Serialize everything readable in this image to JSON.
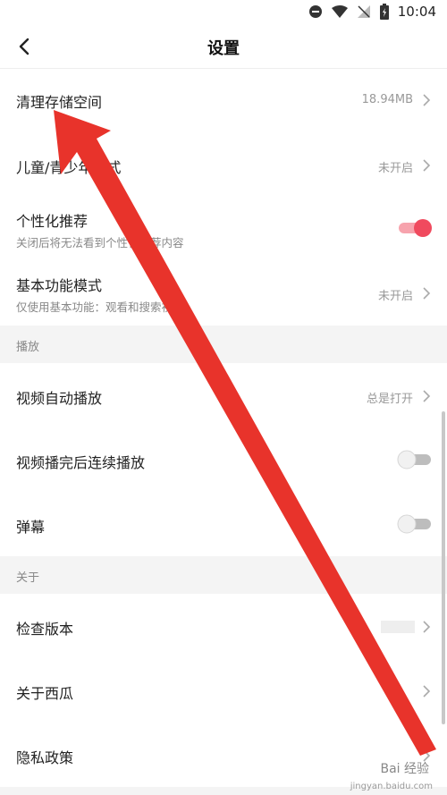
{
  "status": {
    "time": "10:04"
  },
  "header": {
    "title": "设置"
  },
  "rows": [
    {
      "label": "清理存储空间",
      "value": "18.94MB"
    },
    {
      "label": "儿童/青少年模式",
      "value": "未开启"
    },
    {
      "label": "个性化推荐",
      "sub": "关闭后将无法看到个性化推荐内容",
      "toggle": "on"
    },
    {
      "label": "基本功能模式",
      "sub": "仅使用基本功能：观看和搜索视频",
      "value": "未开启"
    },
    {
      "label": "视频自动播放",
      "value": "总是打开"
    },
    {
      "label": "视频播完后连续播放",
      "toggle": "off"
    },
    {
      "label": "弹幕",
      "toggle": "off"
    },
    {
      "label": "检查版本"
    },
    {
      "label": "关于西瓜"
    },
    {
      "label": "隐私政策"
    }
  ],
  "sections": {
    "play": "播放",
    "about": "关于"
  },
  "watermark": {
    "text": "Bai 经验",
    "url": "jingyan.baidu.com"
  },
  "colors": {
    "accent": "#f04a5e",
    "arrow": "#e8332b"
  }
}
